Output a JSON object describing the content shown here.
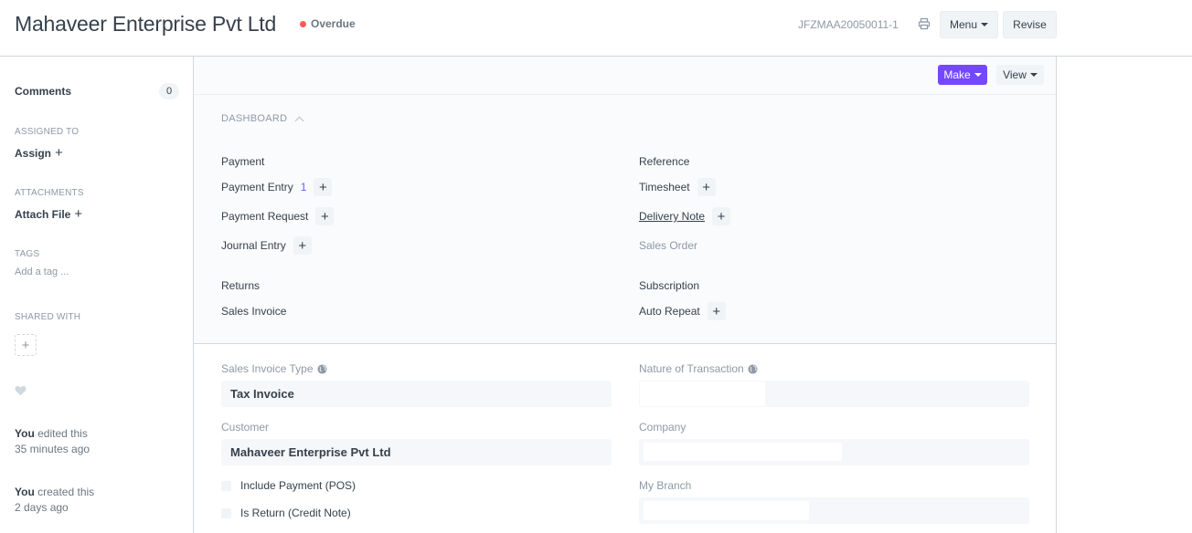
{
  "header": {
    "title": "Mahaveer Enterprise Pvt Ltd",
    "status": "Overdue",
    "status_color": "#ff5858",
    "doc_name": "JFZMAA20050011-1",
    "menu_label": "Menu",
    "revise_label": "Revise",
    "print_icon": "printer-icon"
  },
  "sidebar": {
    "comments_label": "Comments",
    "comments_count": "0",
    "assigned_to_label": "ASSIGNED TO",
    "assign_label": "Assign",
    "attachments_label": "ATTACHMENTS",
    "attach_label": "Attach File",
    "tags_label": "TAGS",
    "tag_placeholder": "Add a tag ...",
    "shared_with_label": "SHARED WITH",
    "activity": [
      {
        "who": "You",
        "action": "edited this",
        "when": "35 minutes ago"
      },
      {
        "who": "You",
        "action": "created this",
        "when": "2 days ago"
      }
    ]
  },
  "toolbar": {
    "make_label": "Make",
    "make_color": "#7448ff",
    "view_label": "View"
  },
  "dashboard": {
    "title": "DASHBOARD",
    "groups": [
      {
        "title": "Payment",
        "links": [
          {
            "label": "Payment Entry",
            "count": "1"
          },
          {
            "label": "Payment Request"
          },
          {
            "label": "Journal Entry"
          }
        ]
      },
      {
        "title": "Reference",
        "links": [
          {
            "label": "Timesheet"
          },
          {
            "label": "Delivery Note"
          },
          {
            "label": "Sales Order"
          }
        ]
      },
      {
        "title": "Returns",
        "links": [
          {
            "label": "Sales Invoice"
          }
        ]
      },
      {
        "title": "Subscription",
        "links": [
          {
            "label": "Auto Repeat"
          }
        ]
      }
    ]
  },
  "form": {
    "sales_invoice_type_label": "Sales Invoice Type",
    "sales_invoice_type_value": "Tax Invoice",
    "nature_of_transaction_label": "Nature of Transaction",
    "nature_of_transaction_value": "",
    "customer_label": "Customer",
    "customer_value": "Mahaveer Enterprise Pvt Ltd",
    "company_label": "Company",
    "company_value": "",
    "my_branch_label": "My Branch",
    "my_branch_value": "",
    "include_payment_label": "Include Payment (POS)",
    "is_return_label": "Is Return (Credit Note)"
  }
}
